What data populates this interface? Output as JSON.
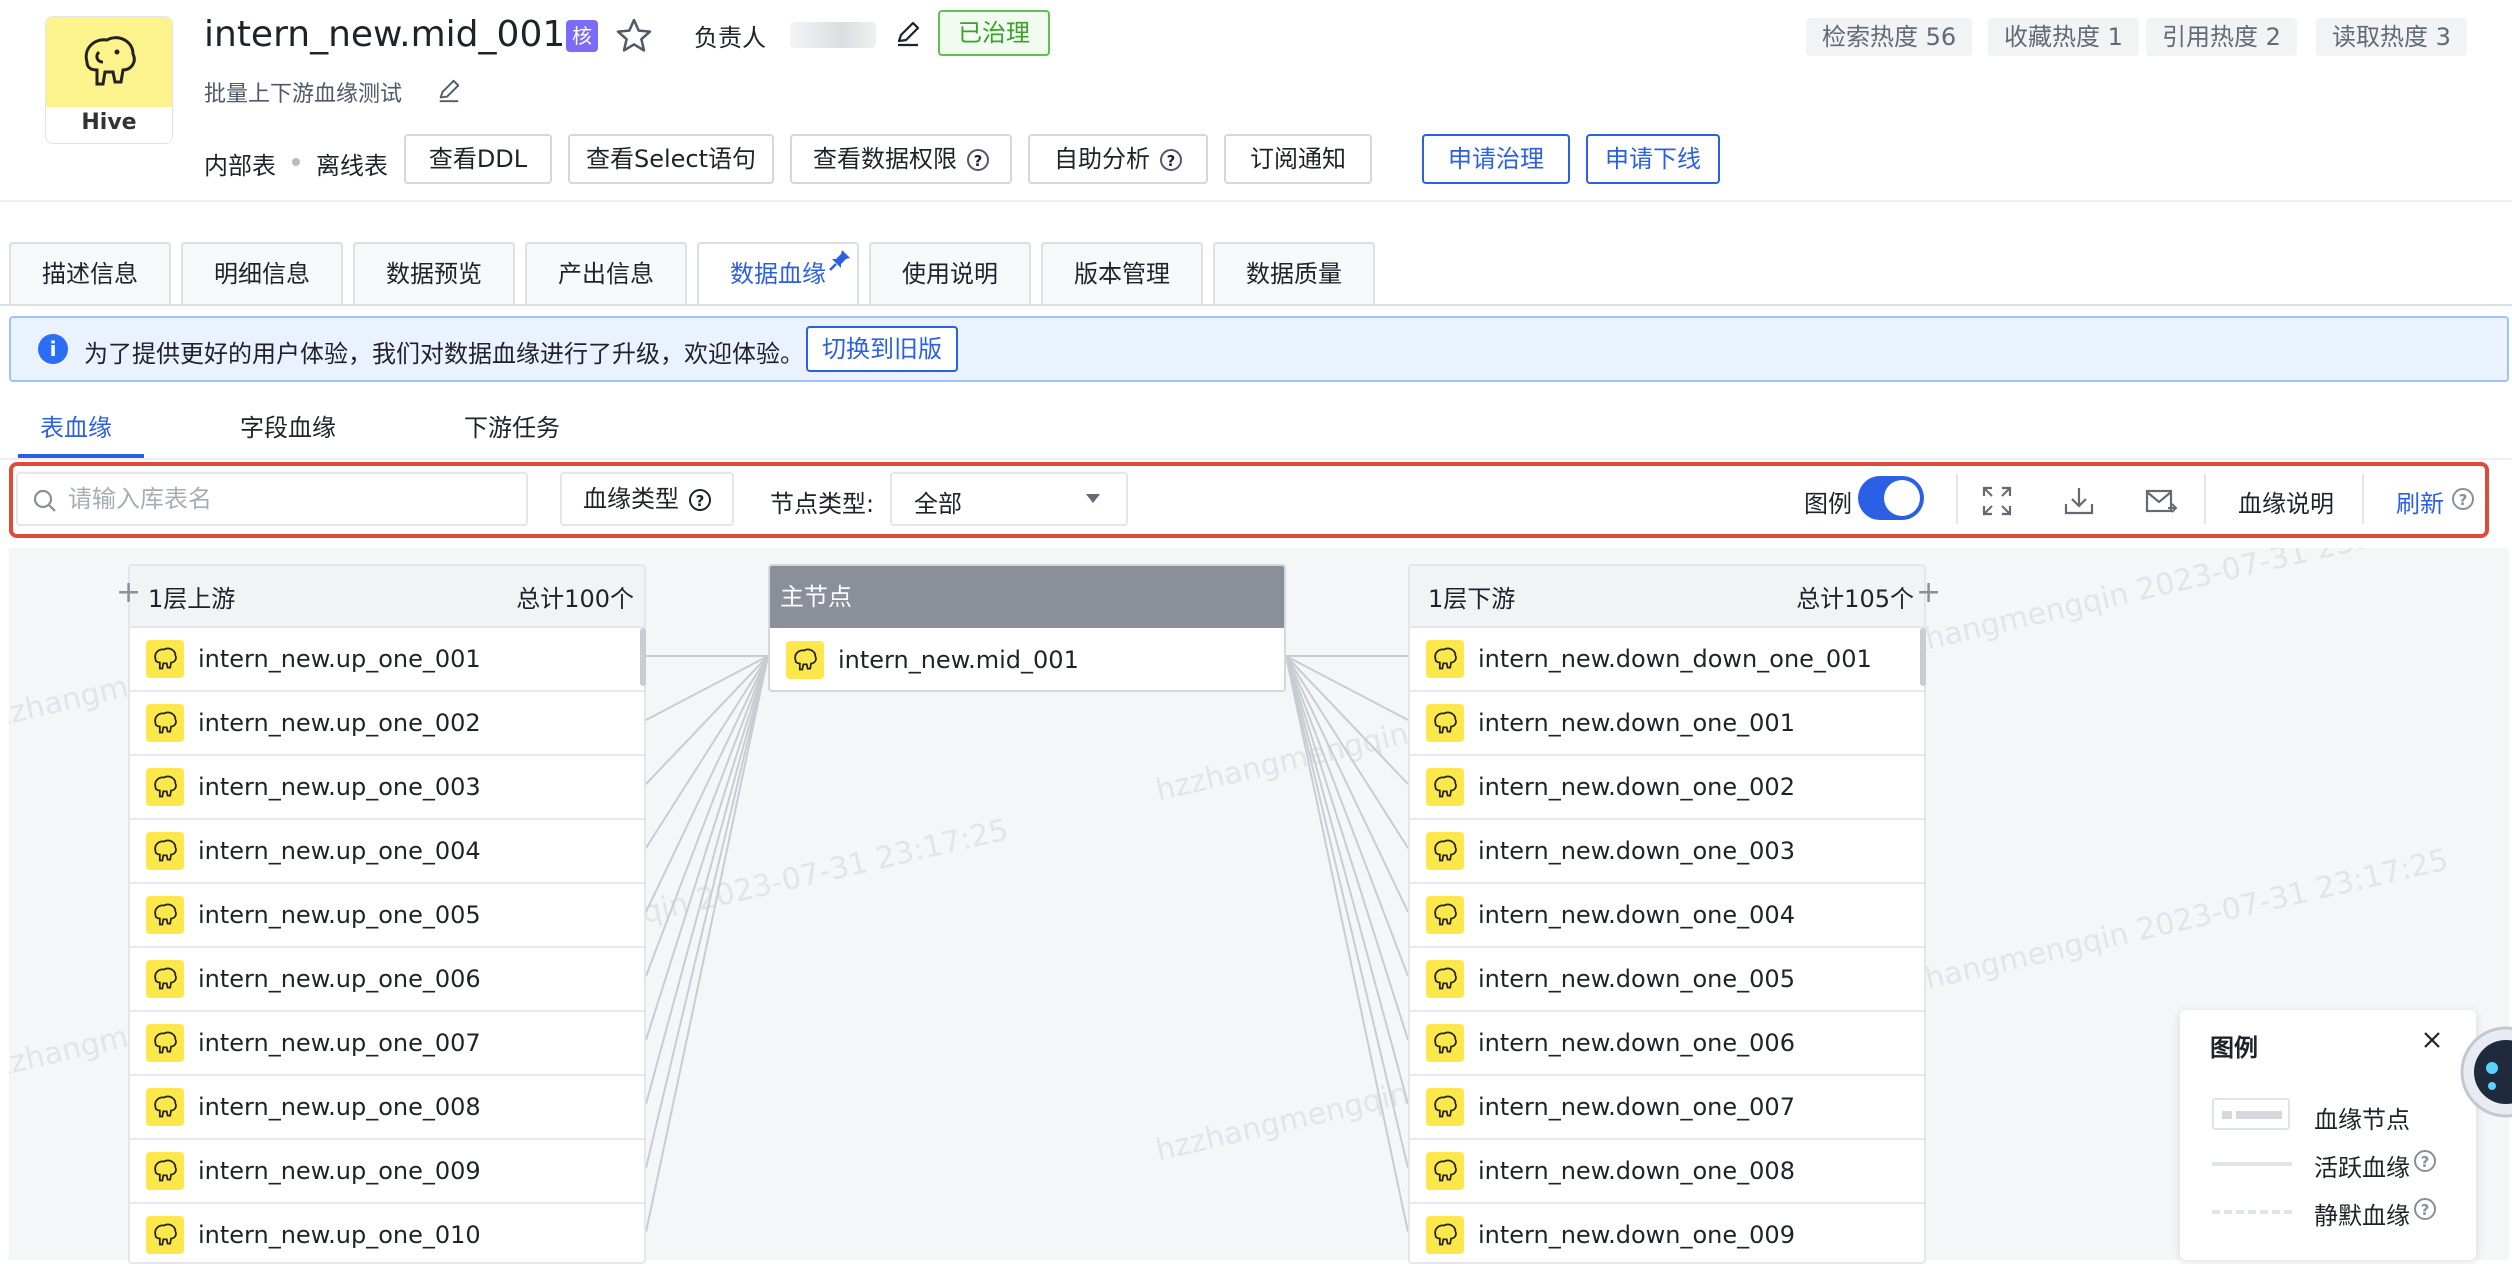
{
  "header": {
    "logo_label": "Hive",
    "title": "intern_new.mid_001",
    "core_tag": "核",
    "owner_label": "负责人",
    "governed_badge": "已治理",
    "subtitle": "批量上下游血缘测试",
    "heat": [
      "检索热度 56",
      "收藏热度 1",
      "引用热度 2",
      "读取热度 3"
    ],
    "meta": [
      "内部表",
      "离线表"
    ],
    "actions": [
      "查看DDL",
      "查看Select语句",
      "查看数据权限",
      "自助分析",
      "订阅通知"
    ],
    "primary_actions": [
      "申请治理",
      "申请下线"
    ]
  },
  "tabs": [
    "描述信息",
    "明细信息",
    "数据预览",
    "产出信息",
    "数据血缘",
    "使用说明",
    "版本管理",
    "数据质量"
  ],
  "active_tab": "数据血缘",
  "notice": {
    "text": "为了提供更好的用户体验，我们对数据血缘进行了升级，欢迎体验。",
    "button": "切换到旧版"
  },
  "sub_tabs": [
    "表血缘",
    "字段血缘",
    "下游任务"
  ],
  "toolbar": {
    "search_placeholder": "请输入库表名",
    "lineage_type": "血缘类型",
    "node_type_label": "节点类型:",
    "node_type_value": "全部",
    "legend_label": "图例",
    "legend_on": true,
    "lineage_desc": "血缘说明",
    "refresh": "刷新"
  },
  "graph": {
    "upstream": {
      "title": "1层上游",
      "total": "总计100个",
      "nodes": [
        "intern_new.up_one_001",
        "intern_new.up_one_002",
        "intern_new.up_one_003",
        "intern_new.up_one_004",
        "intern_new.up_one_005",
        "intern_new.up_one_006",
        "intern_new.up_one_007",
        "intern_new.up_one_008",
        "intern_new.up_one_009",
        "intern_new.up_one_010"
      ]
    },
    "main": {
      "title": "主节点",
      "node": "intern_new.mid_001"
    },
    "downstream": {
      "title": "1层下游",
      "total": "总计105个",
      "nodes": [
        "intern_new.down_down_one_001",
        "intern_new.down_one_001",
        "intern_new.down_one_002",
        "intern_new.down_one_003",
        "intern_new.down_one_004",
        "intern_new.down_one_005",
        "intern_new.down_one_006",
        "intern_new.down_one_007",
        "intern_new.down_one_008",
        "intern_new.down_one_009"
      ]
    }
  },
  "legend": {
    "title": "图例",
    "items": [
      "血缘节点",
      "活跃血缘",
      "静默血缘"
    ]
  },
  "watermark": "hzzhangmengqin 2023-07-31 23:17:25",
  "colors": {
    "accent": "#2b5fe4",
    "governed": "#3aa12b",
    "highlight": "#e04a3a",
    "hive_yellow": "#fde74c"
  }
}
